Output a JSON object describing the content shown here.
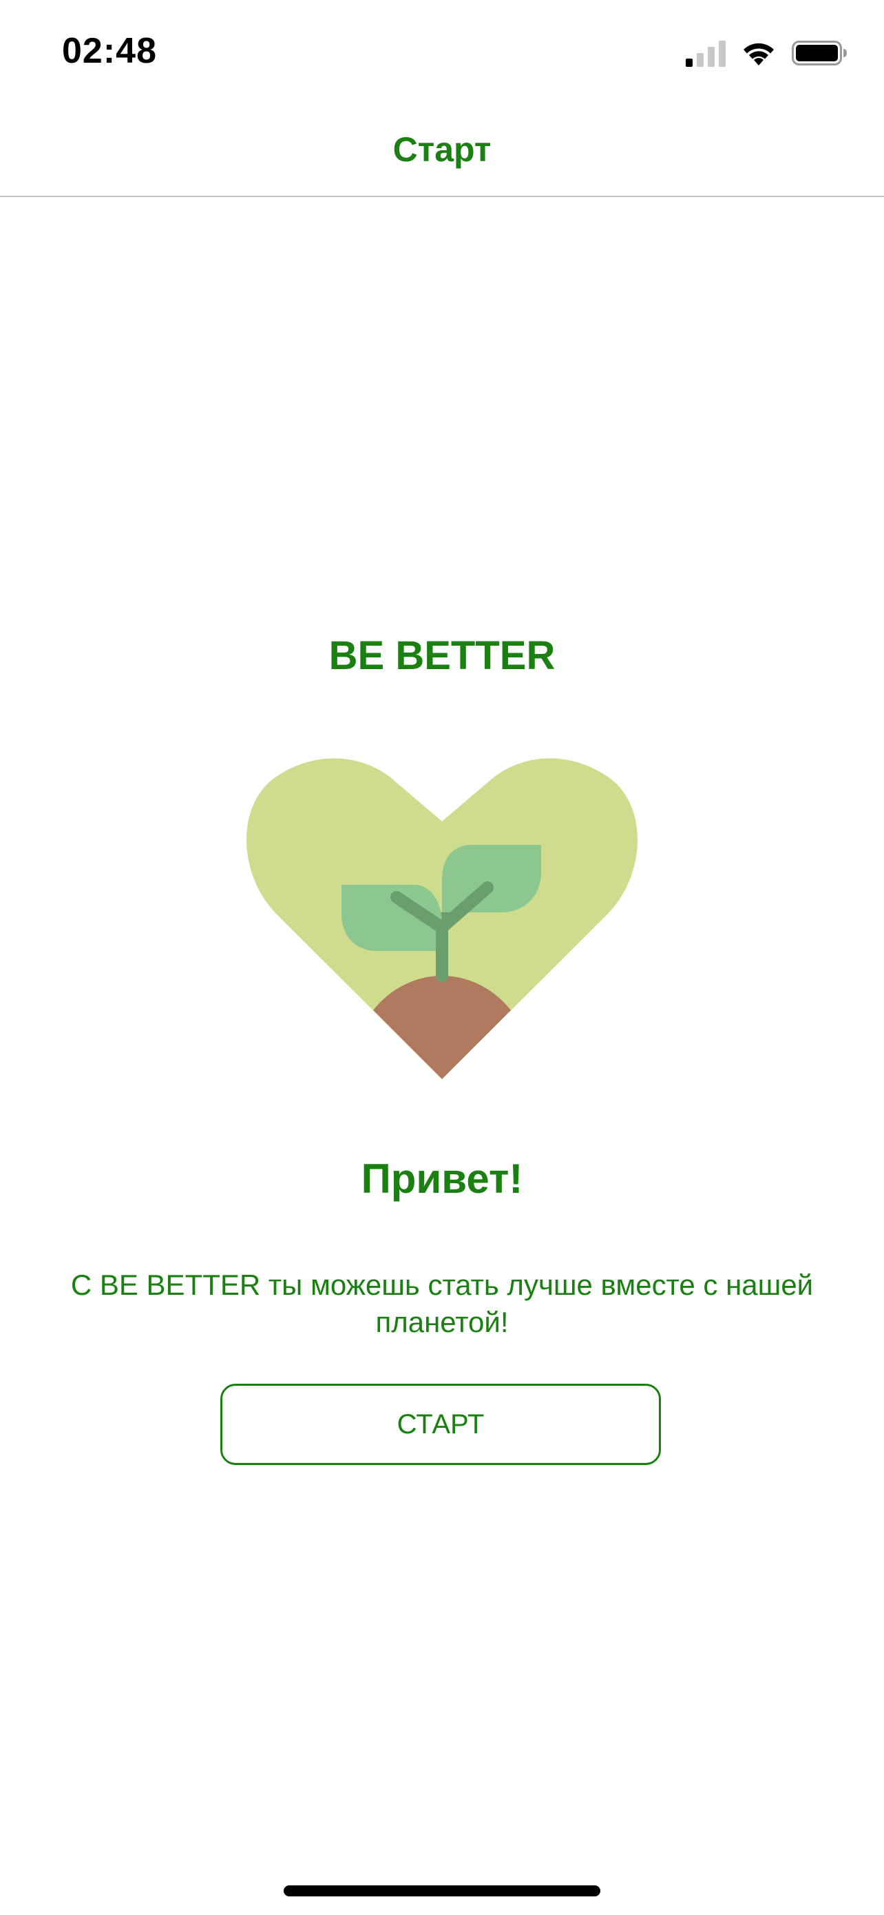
{
  "status_bar": {
    "time": "02:48",
    "icons": [
      "cellular-signal-icon",
      "wifi-icon",
      "battery-icon"
    ]
  },
  "nav": {
    "title": "Старт"
  },
  "main": {
    "brand_title": "BE BETTER",
    "logo_icon": "heart-sprout-icon",
    "greeting": "Привет!",
    "description": "С BE BETTER ты можешь стать лучше вместе с нашей планетой!",
    "start_button_label": "СТАРТ"
  },
  "colors": {
    "accent_green": "#1a8012",
    "heart_light_green": "#cfdc8d",
    "leaf_green": "#8cc78f",
    "stem_green": "#6a9f6d",
    "soil_brown": "#b07a5f"
  }
}
